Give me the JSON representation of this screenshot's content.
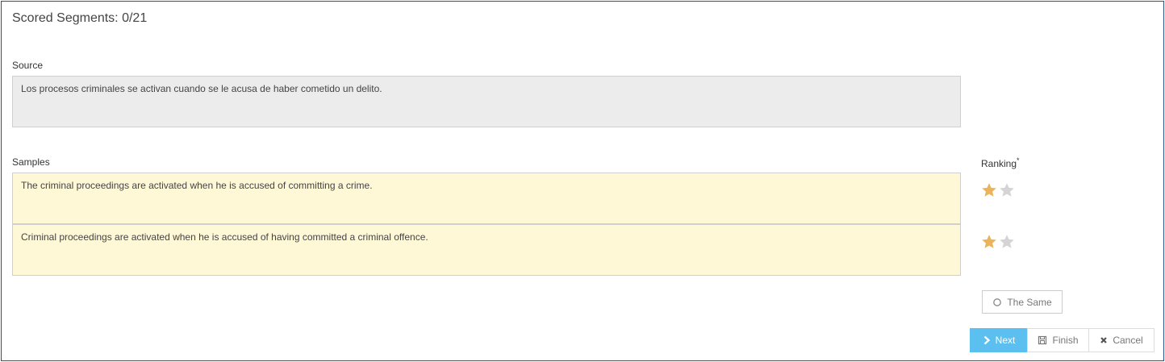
{
  "header": {
    "scored_segments": "Scored Segments: 0/21"
  },
  "source": {
    "label": "Source",
    "text": "Los procesos criminales se activan cuando se le acusa de haber cometido un delito."
  },
  "samples": {
    "label": "Samples",
    "items": [
      {
        "text": "The criminal proceedings are activated when he is accused of committing a crime.",
        "rating": 1,
        "max_rating": 2
      },
      {
        "text": "Criminal proceedings are activated when he is accused of having committed a criminal offence.",
        "rating": 1,
        "max_rating": 2
      }
    ]
  },
  "ranking": {
    "label": "Ranking",
    "required_marker": "*"
  },
  "buttons": {
    "same": {
      "label": "The Same",
      "icon": "circle-icon"
    },
    "next": {
      "label": "Next",
      "icon": "chevron-right-icon"
    },
    "finish": {
      "label": "Finish",
      "icon": "save-icon"
    },
    "cancel": {
      "label": "Cancel",
      "icon": "close-icon"
    }
  },
  "colors": {
    "star_filled": "#e9b45a",
    "star_empty": "#d4d4d4",
    "next_bg": "#5bc0f0",
    "sample_bg": "#fff8d7",
    "source_bg": "#ececec"
  }
}
